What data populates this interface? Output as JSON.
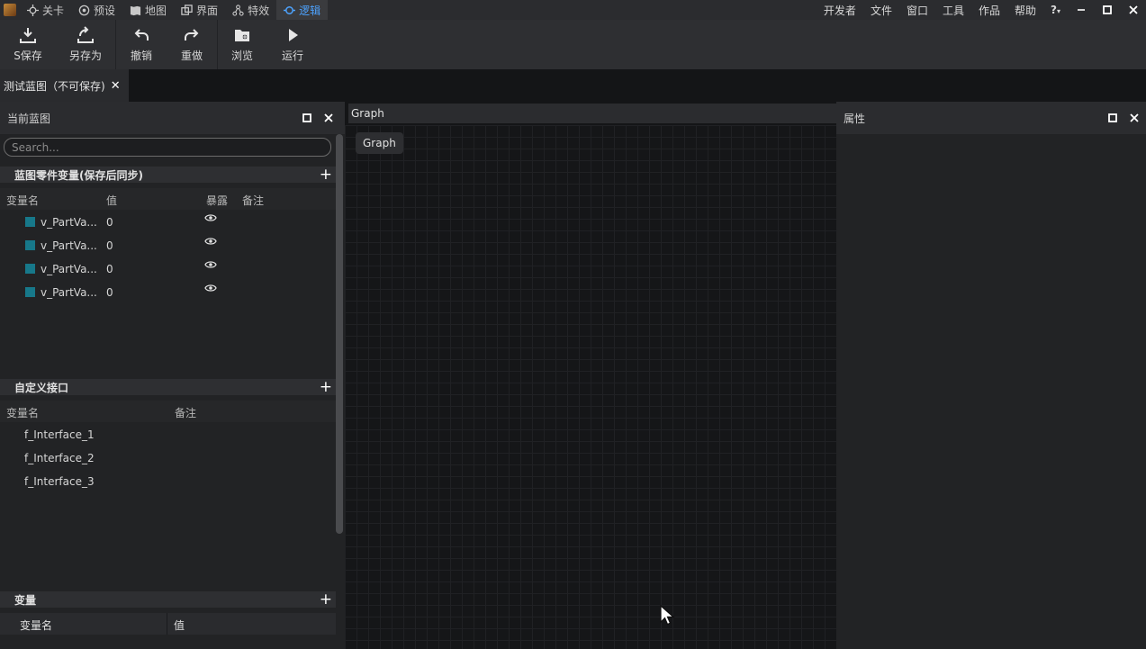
{
  "menubar": {
    "tabs": [
      {
        "label": "关卡",
        "icon": "crosshair-icon"
      },
      {
        "label": "预设",
        "icon": "circle-dot-icon"
      },
      {
        "label": "地图",
        "icon": "map-icon"
      },
      {
        "label": "界面",
        "icon": "window-icon"
      },
      {
        "label": "特效",
        "icon": "sparkle-icon"
      },
      {
        "label": "逻辑",
        "icon": "logic-link-icon"
      }
    ],
    "active_tab": "逻辑",
    "active_color": "#4da3ff",
    "right_items": [
      "开发者",
      "文件",
      "窗口",
      "工具",
      "作品",
      "帮助"
    ],
    "help_glyph": "?"
  },
  "toolbar": {
    "buttons": [
      {
        "label": "S保存",
        "icon": "save-download-icon"
      },
      {
        "label": "另存为",
        "icon": "save-as-icon"
      },
      {
        "label": "撤销",
        "icon": "undo-icon"
      },
      {
        "label": "重做",
        "icon": "redo-icon"
      },
      {
        "label": "浏览",
        "icon": "browse-folder-icon"
      },
      {
        "label": "运行",
        "icon": "play-icon"
      }
    ]
  },
  "doc_tab": {
    "label": "测试蓝图（不可保存)",
    "close_glyph": "✕"
  },
  "left_panel": {
    "title": "当前蓝图",
    "search_placeholder": "Search...",
    "part_vars": {
      "title": "蓝图零件变量(保存后同步)",
      "columns": [
        "变量名",
        "值",
        "暴露",
        "备注"
      ],
      "rows": [
        {
          "name": "v_PartVa...",
          "value": "0",
          "exposed": true
        },
        {
          "name": "v_PartVa...",
          "value": "0",
          "exposed": true
        },
        {
          "name": "v_PartVa...",
          "value": "0",
          "exposed": true
        },
        {
          "name": "v_PartVa...",
          "value": "0",
          "exposed": true
        }
      ],
      "swatch_color": "#17788a"
    },
    "interfaces": {
      "title": "自定义接口",
      "columns": [
        "变量名",
        "备注"
      ],
      "rows": [
        "f_Interface_1",
        "f_Interface_2",
        "f_Interface_3"
      ]
    },
    "variables": {
      "title": "变量",
      "columns": [
        "变量名",
        "值"
      ]
    }
  },
  "graph_panel": {
    "title": "Graph",
    "breadcrumb": "Graph"
  },
  "prop_panel": {
    "title": "属性"
  }
}
